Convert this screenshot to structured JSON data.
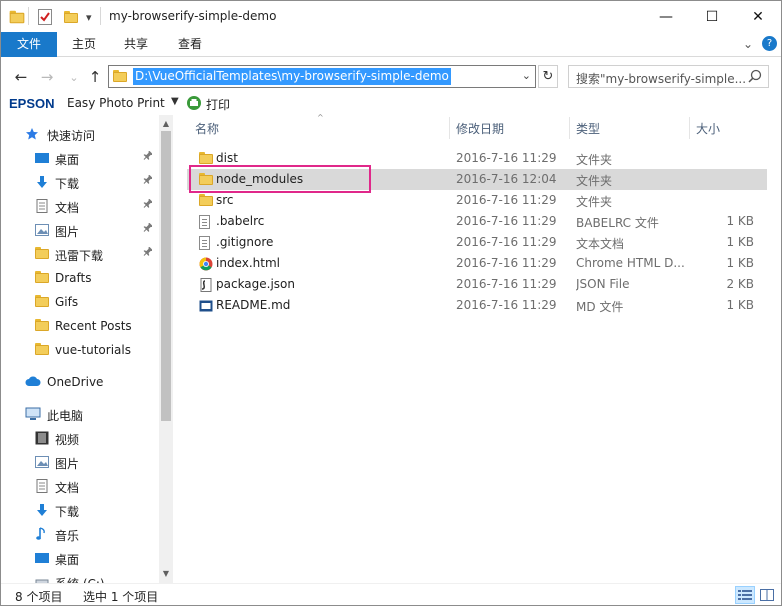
{
  "window": {
    "title": "my-browserify-simple-demo",
    "minimize_glyph": "—",
    "maximize_glyph": "☐",
    "close_glyph": "✕",
    "qa_dropdown_glyph": "▾"
  },
  "ribbon": {
    "tabs": [
      "文件",
      "主页",
      "共享",
      "查看"
    ],
    "collapse_glyph": "⌄",
    "help_glyph": "?"
  },
  "address": {
    "back_glyph": "←",
    "forward_glyph": "→",
    "recent_glyph": "⌄",
    "up_glyph": "↑",
    "path": "D:\\VueOfficialTemplates\\my-browserify-simple-demo",
    "dropdown_glyph": "⌄",
    "refresh_glyph": "↻",
    "search_placeholder": "搜索\"my-browserify-simple..."
  },
  "epson": {
    "brand": "EPSON",
    "app": "Easy Photo Print",
    "dropdown_glyph": "▼",
    "print_label": "打印"
  },
  "nav": {
    "scroll_up_glyph": "▲",
    "scroll_down_glyph": "▼",
    "pin_glyph": "📌",
    "items": [
      {
        "label": "快速访问",
        "icon": "star-icon"
      },
      {
        "label": "桌面",
        "icon": "desktop-icon",
        "pinned": true
      },
      {
        "label": "下载",
        "icon": "download-icon",
        "pinned": true
      },
      {
        "label": "文档",
        "icon": "document-icon",
        "pinned": true
      },
      {
        "label": "图片",
        "icon": "picture-icon",
        "pinned": true
      },
      {
        "label": "迅雷下载",
        "icon": "folder-icon",
        "pinned": true
      },
      {
        "label": "Drafts",
        "icon": "folder-icon"
      },
      {
        "label": "Gifs",
        "icon": "folder-icon"
      },
      {
        "label": "Recent Posts",
        "icon": "folder-icon"
      },
      {
        "label": "vue-tutorials",
        "icon": "folder-icon"
      },
      {
        "label": "OneDrive",
        "icon": "cloud-icon"
      },
      {
        "label": "此电脑",
        "icon": "computer-icon"
      },
      {
        "label": "视频",
        "icon": "video-icon"
      },
      {
        "label": "图片",
        "icon": "picture-icon"
      },
      {
        "label": "文档",
        "icon": "document-icon"
      },
      {
        "label": "下载",
        "icon": "download-icon"
      },
      {
        "label": "音乐",
        "icon": "music-icon"
      },
      {
        "label": "桌面",
        "icon": "desktop-icon"
      },
      {
        "label": "系统 (C:)",
        "icon": "drive-icon"
      }
    ]
  },
  "content": {
    "sort_glyph": "^",
    "columns": {
      "name": "名称",
      "date": "修改日期",
      "type": "类型",
      "size": "大小"
    },
    "files": [
      {
        "name": "dist",
        "date": "2016-7-16 11:29",
        "type": "文件夹",
        "size": "",
        "icon": "folder-icon"
      },
      {
        "name": "node_modules",
        "date": "2016-7-16 12:04",
        "type": "文件夹",
        "size": "",
        "icon": "folder-icon",
        "selected": true
      },
      {
        "name": "src",
        "date": "2016-7-16 11:29",
        "type": "文件夹",
        "size": "",
        "icon": "folder-icon"
      },
      {
        "name": ".babelrc",
        "date": "2016-7-16 11:29",
        "type": "BABELRC 文件",
        "size": "1 KB",
        "icon": "file-icon"
      },
      {
        "name": ".gitignore",
        "date": "2016-7-16 11:29",
        "type": "文本文档",
        "size": "1 KB",
        "icon": "text-file-icon"
      },
      {
        "name": "index.html",
        "date": "2016-7-16 11:29",
        "type": "Chrome HTML D...",
        "size": "1 KB",
        "icon": "chrome-icon"
      },
      {
        "name": "package.json",
        "date": "2016-7-16 11:29",
        "type": "JSON File",
        "size": "2 KB",
        "icon": "json-file-icon"
      },
      {
        "name": "README.md",
        "date": "2016-7-16 11:29",
        "type": "MD 文件",
        "size": "1 KB",
        "icon": "markdown-file-icon"
      }
    ]
  },
  "status": {
    "item_count": "8 个项目",
    "selected": "选中 1 个项目"
  },
  "colors": {
    "accent": "#1979ca",
    "selection": "#3399ff",
    "selected_row": "#d9d9d9",
    "highlight_box": "#e0288a"
  }
}
